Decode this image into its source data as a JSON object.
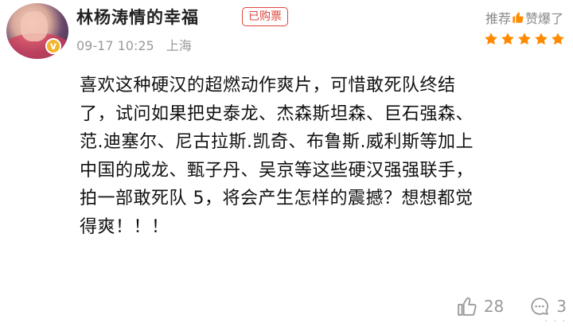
{
  "user": {
    "name": "林杨涛情的幸福",
    "badge": "已购票",
    "date": "09-17 10:25",
    "location": "上海"
  },
  "recommend": {
    "label_left": "推荐",
    "label_right": "赞爆了",
    "stars": 5
  },
  "review": {
    "lines": [
      "喜欢这种硬汉的超燃动作爽片，可惜敢死队终结",
      "了，试问如果把史泰龙、杰森斯坦森、巨石强森、",
      "范.迪塞尔、尼古拉斯.凯奇、布鲁斯.威利斯等加上",
      "中国的成龙、甄子丹、吴京等这些硬汉强强联手，",
      "拍一部敢死队 5，将会产生怎样的震撼？想想都觉",
      "得爽！！！"
    ]
  },
  "footer": {
    "likes": "28",
    "comments": "3",
    "watermark": "· · ·"
  },
  "colors": {
    "accent_red": "#e0463c",
    "star_orange": "#ff8a00",
    "muted": "#9a9a9a"
  }
}
